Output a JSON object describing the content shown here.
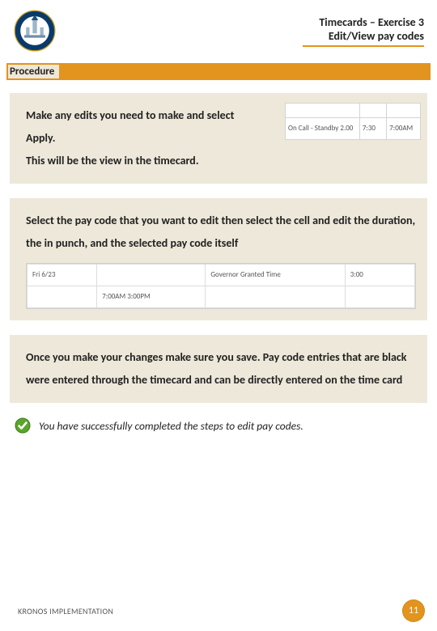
{
  "header": {
    "title_line1": "Timecards – Exercise 3",
    "title_line2": "Edit/View pay codes",
    "seal_label": "Connecticut DAS seal"
  },
  "procedure_label": "Procedure",
  "block1": {
    "text_a": "Make any edits you need to make and select Apply.",
    "text_b": "This will be the view in the timecard.",
    "table": {
      "paycode": "On Call - Standby 2.00",
      "duration": "7:30",
      "in": "7:00AM"
    }
  },
  "block2": {
    "text": "Select the pay code that you want to edit then select the cell and edit the duration, the in punch, and the selected pay code itself",
    "table": {
      "r1c1": "Fri 6/23",
      "r1c3": "Governor Granted Time",
      "r1c4": "3:00",
      "r2c2": "7:00AM 3:00PM"
    }
  },
  "block3": {
    "text": "Once you make your changes make sure you save. Pay code entries that are black were entered through the timecard and can be directly entered on the time card"
  },
  "success": {
    "text": "You have successfully completed the steps to edit pay codes."
  },
  "footer": {
    "label": "KRONOS IMPLEMENTATION",
    "page": "11"
  },
  "colors": {
    "accent": "#e2941f",
    "panel": "#ede8d9"
  }
}
